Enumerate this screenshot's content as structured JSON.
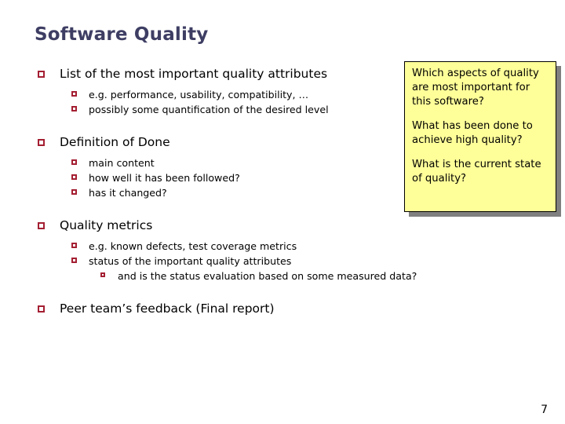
{
  "slide": {
    "title": "Software Quality",
    "page_number": "7",
    "accent_color": "#a41f32",
    "title_color": "#3e3e64",
    "callout_bg": "#ffff99",
    "callout_border": "#000000",
    "callout_shadow": "#808080",
    "background": "#ffffff"
  },
  "outline": [
    {
      "text": "List of the most important quality attributes",
      "children": [
        {
          "text": "e.g. performance, usability, compatibility, …"
        },
        {
          "text": "possibly some quantification of the desired level"
        }
      ]
    },
    {
      "text": "Definition of Done",
      "children": [
        {
          "text": "main content"
        },
        {
          "text": "how well it has been followed?"
        },
        {
          "text": "has it changed?"
        }
      ]
    },
    {
      "text": "Quality metrics",
      "children": [
        {
          "text": "e.g. known defects, test coverage metrics"
        },
        {
          "text": "status of the important quality attributes",
          "children": [
            {
              "text": "and is the status evaluation based on some measured data?"
            }
          ]
        }
      ]
    },
    {
      "text": "Peer team’s feedback (Final report)",
      "children": []
    }
  ],
  "callout": {
    "paragraphs": [
      "Which aspects of quality are most important for this software?",
      "What has been done to achieve high quality?",
      "What is the current state of quality?"
    ]
  }
}
